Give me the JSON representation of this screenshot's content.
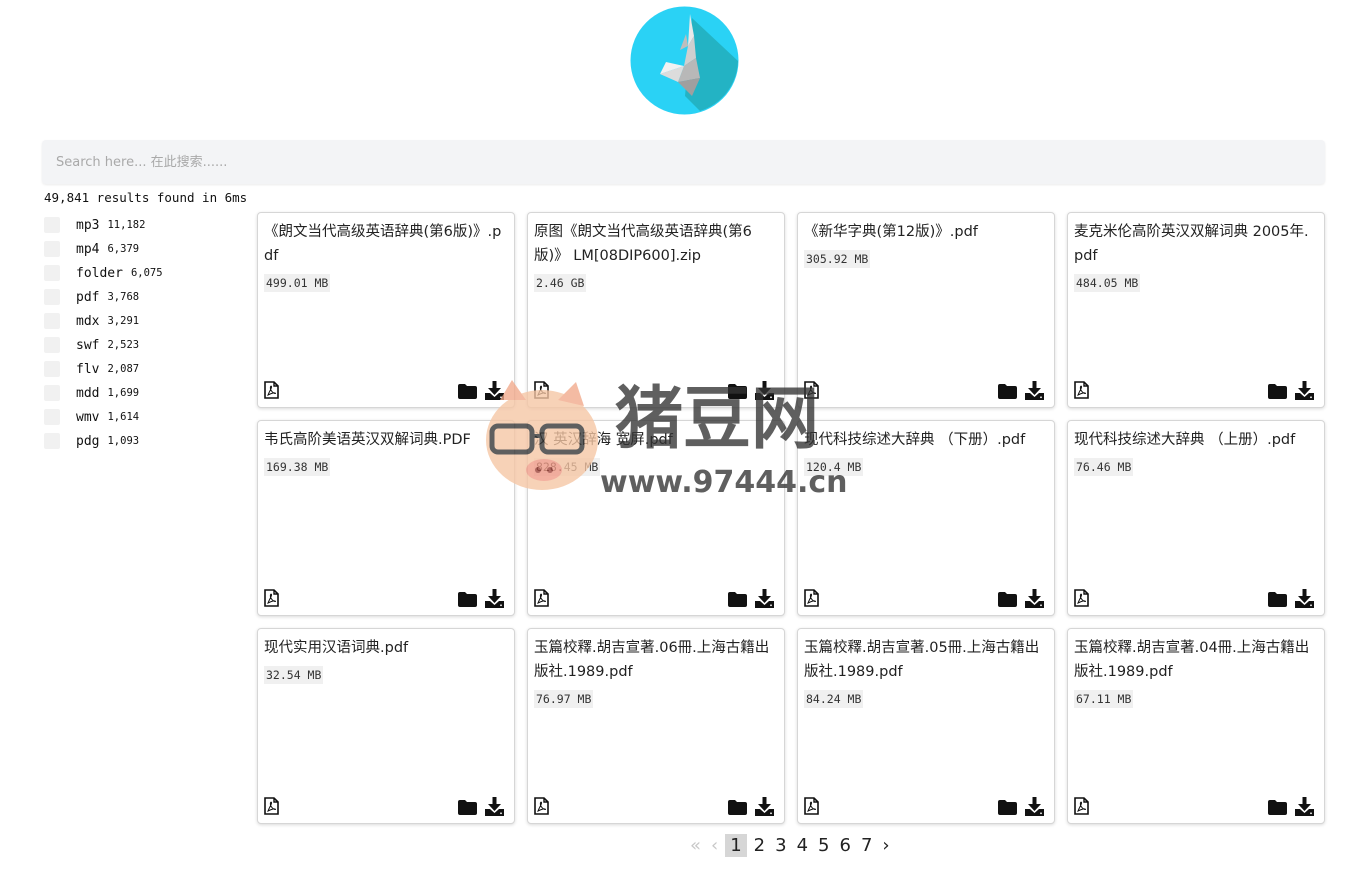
{
  "search": {
    "placeholder": "Search here... 在此搜索......"
  },
  "results_summary": "49,841 results found in 6ms",
  "facets": [
    {
      "name": "mp3",
      "count": "11,182"
    },
    {
      "name": "mp4",
      "count": "6,379"
    },
    {
      "name": "folder",
      "count": "6,075"
    },
    {
      "name": "pdf",
      "count": "3,768"
    },
    {
      "name": "mdx",
      "count": "3,291"
    },
    {
      "name": "swf",
      "count": "2,523"
    },
    {
      "name": "flv",
      "count": "2,087"
    },
    {
      "name": "mdd",
      "count": "1,699"
    },
    {
      "name": "wmv",
      "count": "1,614"
    },
    {
      "name": "pdg",
      "count": "1,093"
    }
  ],
  "results": [
    {
      "title": "《朗文当代高级英语辞典(第6版)》.pdf",
      "size": "499.01 MB"
    },
    {
      "title": "原图《朗文当代高级英语辞典(第6版)》 LM[08DIP600].zip",
      "size": "2.46 GB"
    },
    {
      "title": "《新华字典(第12版)》.pdf",
      "size": "305.92 MB"
    },
    {
      "title": "麦克米伦高阶英汉双解词典 2005年.pdf",
      "size": "484.05 MB"
    },
    {
      "title": "韦氏高阶美语英汉双解词典.PDF",
      "size": "169.38 MB"
    },
    {
      "title": "汉 英汉辞海 宽屏.pdf",
      "size": "828.45 MB"
    },
    {
      "title": "现代科技综述大辞典 （下册）.pdf",
      "size": "120.4 MB"
    },
    {
      "title": "现代科技综述大辞典 （上册）.pdf",
      "size": "76.46 MB"
    },
    {
      "title": "现代实用汉语词典.pdf",
      "size": "32.54 MB"
    },
    {
      "title": "玉篇校釋.胡吉宣著.06冊.上海古籍出版社.1989.pdf",
      "size": "76.97 MB"
    },
    {
      "title": "玉篇校釋.胡吉宣著.05冊.上海古籍出版社.1989.pdf",
      "size": "84.24 MB"
    },
    {
      "title": "玉篇校釋.胡吉宣著.04冊.上海古籍出版社.1989.pdf",
      "size": "67.11 MB"
    }
  ],
  "pagination": {
    "first": "«",
    "prev": "‹",
    "pages": [
      "1",
      "2",
      "3",
      "4",
      "5",
      "6",
      "7"
    ],
    "current": "1",
    "next": "›"
  },
  "watermark": {
    "brand": "猪豆网",
    "url": "www.97444.cn"
  },
  "icons": {
    "logo": "bird-logo-icon",
    "file": "pdf-file-icon",
    "folder": "folder-icon",
    "download": "download-icon"
  },
  "colors": {
    "logo_blue": "#2ad2f5",
    "logo_teal": "#23b3c4",
    "search_bg": "#f3f4f6",
    "current_page_bg": "#d6d6d6"
  }
}
